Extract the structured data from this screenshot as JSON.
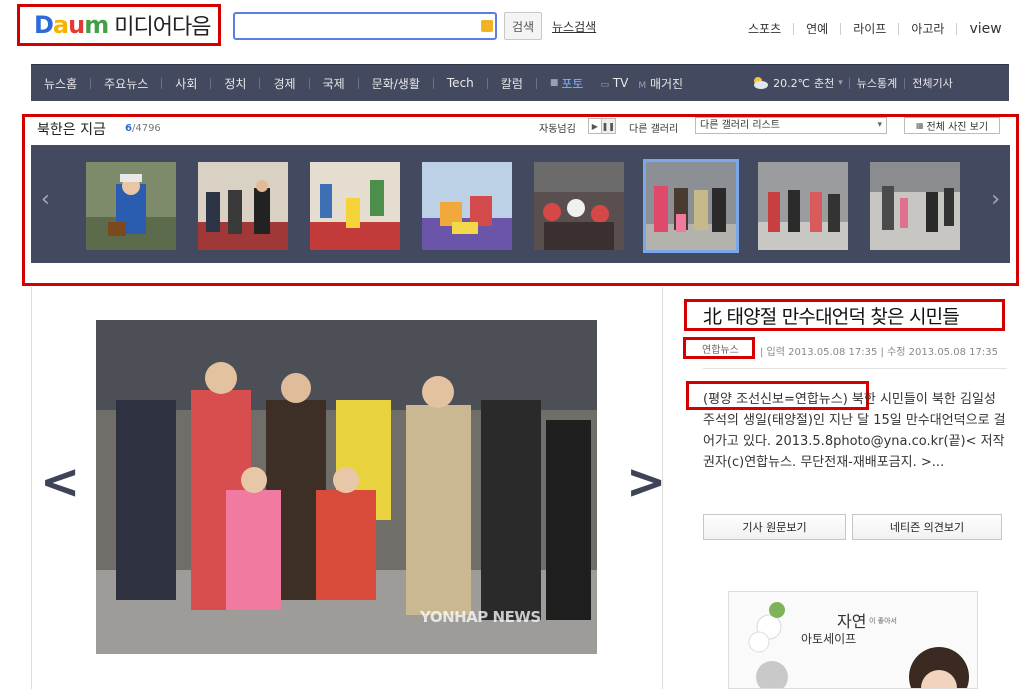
{
  "header": {
    "logo_brand": "Daum",
    "logo_sub": "미디어다음",
    "search_value": "",
    "search_button": "검색",
    "news_search": "뉴스검색",
    "top_links": [
      "스포츠",
      "연예",
      "라이프",
      "아고라",
      "view"
    ]
  },
  "nav": {
    "items": [
      "뉴스홈",
      "주요뉴스",
      "사회",
      "정치",
      "경제",
      "국제",
      "문화/생활",
      "Tech",
      "칼럼"
    ],
    "photo": "포토",
    "tv": "TV",
    "magazine": "매거진",
    "weather_temp": "20.2℃",
    "weather_city": "춘천",
    "right_links": [
      "뉴스통계",
      "전체기사"
    ]
  },
  "gallery": {
    "title": "북한은 지금",
    "current": "6",
    "total": "/4796",
    "auto_label": "자동넘김",
    "other_label": "다른 갤러리",
    "other_select": "다른 갤러리 리스트",
    "all_photos": "전체 사진 보기",
    "selected_index": 5
  },
  "article": {
    "headline": "北 태양절 만수대언덕 찾은 시민들",
    "source": "연합뉴스",
    "meta": "| 입력 2013.05.08 17:35  |  수정 2013.05.08 17:35",
    "caption": "(평양 조선신보=연합뉴스) 북한 시민들이 북한 김일성 주석의 생일(태양절)인 지난 달 15일 만수대언덕으로 걸어가고 있다. 2013.5.8photo@yna.co.kr(끝)< 저작권자(c)연합뉴스. 무단전재-재배포금지. >...",
    "btn_original": "기사 원문보기",
    "btn_comments": "네티즌 의견보기",
    "watermark": "YONHAP NEWS"
  },
  "ad": {
    "title": "자연",
    "small": "이 좋아서",
    "sub": "아토세이프"
  },
  "colors": {
    "highlight_red": "#d40000",
    "nav_bg": "#43495e",
    "accent_blue": "#2e6ad9"
  }
}
